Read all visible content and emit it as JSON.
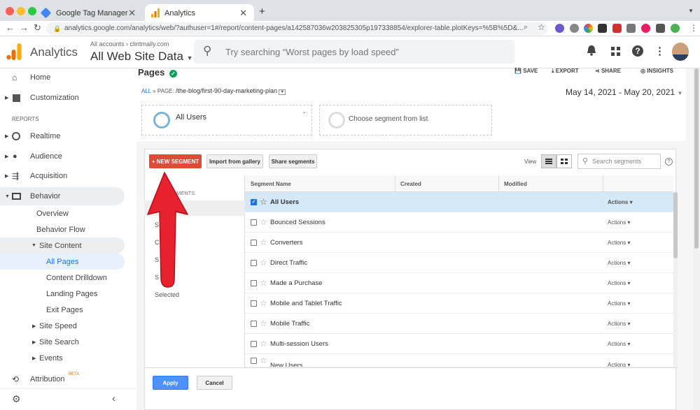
{
  "browser": {
    "tabs": [
      {
        "label": "Google Tag Manager",
        "close": "✕"
      },
      {
        "label": "Analytics",
        "close": "✕"
      }
    ],
    "new_tab": "+",
    "url": "analytics.google.com/analytics/web/?authuser=1#/report/content-pages/a142587036w203825305p197338854/explorer-table.plotKeys=%5B%5D&...",
    "colors": {
      "close": "#ff5f57",
      "minimize": "#febc2e",
      "maximize": "#28c840"
    }
  },
  "header": {
    "product": "Analytics",
    "breadcrumb": "All accounts",
    "account": "clintmally.com",
    "view": "All Web Site Data",
    "search_placeholder": "Try searching “Worst pages by load speed”"
  },
  "sidebar": {
    "items": [
      {
        "label": "Home",
        "icon": "home-icon"
      },
      {
        "label": "Customization",
        "icon": "dashboard-icon"
      },
      {
        "label": "REPORTS"
      },
      {
        "label": "Realtime",
        "icon": "clock-icon"
      },
      {
        "label": "Audience",
        "icon": "person-icon"
      },
      {
        "label": "Acquisition",
        "icon": "acquisition-icon"
      },
      {
        "label": "Behavior",
        "icon": "behavior-icon"
      },
      {
        "label": "Overview"
      },
      {
        "label": "Behavior Flow"
      },
      {
        "label": "Site Content"
      },
      {
        "label": "All Pages"
      },
      {
        "label": "Content Drilldown"
      },
      {
        "label": "Landing Pages"
      },
      {
        "label": "Exit Pages"
      },
      {
        "label": "Site Speed"
      },
      {
        "label": "Site Search"
      },
      {
        "label": "Events"
      },
      {
        "label": "Attribution",
        "badge": "BETA",
        "icon": "attribution-icon"
      }
    ]
  },
  "page": {
    "title": "Pages",
    "actions": [
      "SAVE",
      "EXPORT",
      "SHARE",
      "INSIGHTS"
    ],
    "crumb_all": "ALL",
    "crumb_sep": "»",
    "crumb_page_label": "PAGE:",
    "crumb_page": "/the-blog/first-90-day-marketing-plan",
    "date_range": "May 14, 2021 - May 20, 2021",
    "segment1": "All Users",
    "segment2": "Choose segment from list"
  },
  "segment_panel": {
    "new_segment": "+ NEW SEGMENT",
    "import": "Import from gallery",
    "share": "Share segments",
    "view_label": "View",
    "search_placeholder": "Search segments",
    "left_partial": [
      "MENTS",
      "Al",
      "S",
      "C",
      "S",
      "S",
      "Selected"
    ],
    "columns": [
      "Segment Name",
      "Created",
      "Modified"
    ],
    "rows": [
      {
        "name": "All Users",
        "checked": true,
        "action": "Actions"
      },
      {
        "name": "Bounced Sessions",
        "checked": false,
        "action": "Actions"
      },
      {
        "name": "Converters",
        "checked": false,
        "action": "Actions"
      },
      {
        "name": "Direct Traffic",
        "checked": false,
        "action": "Actions"
      },
      {
        "name": "Made a Purchase",
        "checked": false,
        "action": "Actions"
      },
      {
        "name": "Mobile and Tablet Traffic",
        "checked": false,
        "action": "Actions"
      },
      {
        "name": "Mobile Traffic",
        "checked": false,
        "action": "Actions"
      },
      {
        "name": "Multi-session Users",
        "checked": false,
        "action": "Actions"
      },
      {
        "name": "New Users",
        "checked": false,
        "action": "Actions"
      }
    ],
    "apply": "Apply",
    "cancel": "Cancel"
  },
  "annotation": {
    "arrow_color": "#e8212e"
  }
}
